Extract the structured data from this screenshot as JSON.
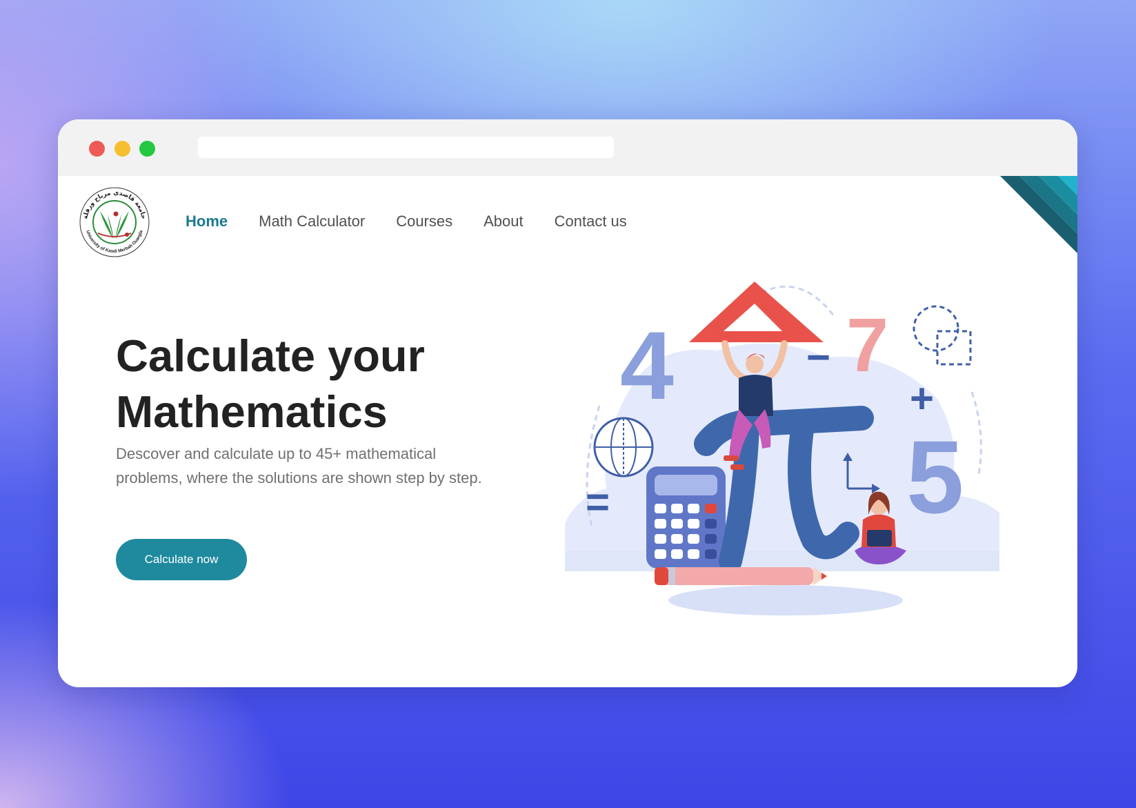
{
  "nav": {
    "items": [
      {
        "label": "Home",
        "active": true
      },
      {
        "label": "Math Calculator",
        "active": false
      },
      {
        "label": "Courses",
        "active": false
      },
      {
        "label": "About",
        "active": false
      },
      {
        "label": "Contact us",
        "active": false
      }
    ]
  },
  "logo": {
    "arabic_text": "جامعة قاصدي مرباح ورقلة",
    "english_text": "University of Kasdi Merbah Ouargla"
  },
  "hero": {
    "title_line1": "Calculate your",
    "title_line2": "Mathematics",
    "description": "Descover and calculate up to 45+ mathematical problems, where the solutions are shown step by step.",
    "cta_label": "Calculate now"
  },
  "illustration": {
    "glyphs": {
      "four": "4",
      "seven": "7",
      "five": "5",
      "minus": "−",
      "plus": "+",
      "equals": "="
    }
  },
  "colors": {
    "accent": "#1f8a9d",
    "nav_active": "#1c7a8d",
    "title": "#222222",
    "muted_text": "#707070"
  }
}
